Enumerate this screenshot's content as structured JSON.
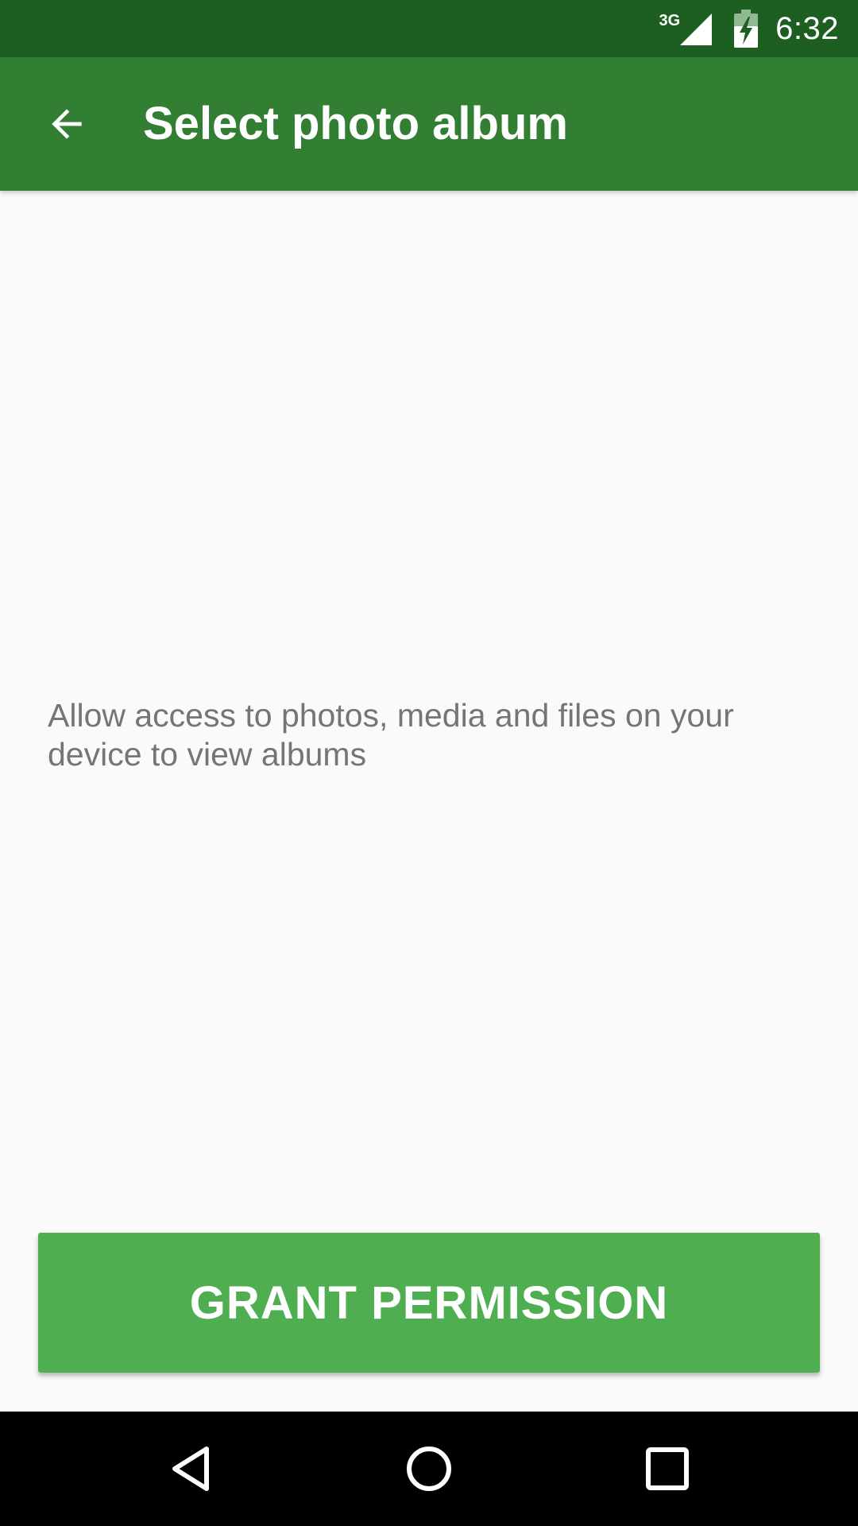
{
  "status_bar": {
    "network_type": "3G",
    "time": "6:32",
    "icons": [
      "signal-icon",
      "battery-charging-icon"
    ]
  },
  "app_bar": {
    "back_icon": "arrow-back-icon",
    "title": "Select photo album"
  },
  "content": {
    "message": "Allow access to photos, media and files on your device to view albums"
  },
  "actions": {
    "grant_label": "GRANT PERMISSION"
  },
  "nav_bar": {
    "icons": [
      "nav-back-icon",
      "nav-home-icon",
      "nav-recents-icon"
    ]
  },
  "colors": {
    "status_bar": "#1d5e21",
    "app_bar": "#327f34",
    "button": "#4fae50",
    "background": "#fafafa",
    "message_text": "#757575"
  }
}
